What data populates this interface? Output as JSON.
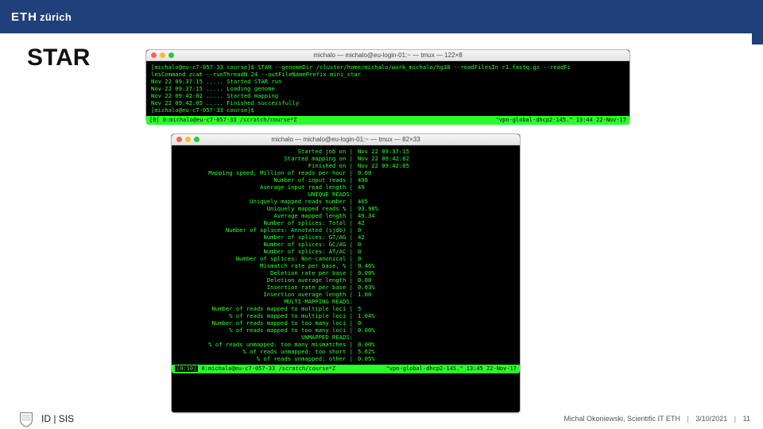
{
  "header": {
    "logo_text_eth": "ETH",
    "logo_text_sub": "zürich"
  },
  "title": "STAR",
  "terminal1": {
    "window_title": "michalo — michalo@eu-login-01:~ — tmux — 122×8",
    "lines": [
      "[michalo@eu-c7-057-33 course]$ STAR --genomeDir /cluster/home/michalo/work_michalo/hg38 --readFilesIn r1.fastq.gz --readFi",
      "lesCommand zcat --runThreadN 24 --outFileNamePrefix mini_star",
      "Nov 22 09:37:15 ..... Started STAR run",
      "Nov 22 09:37:15 ..... Loading genome",
      "Nov 22 09:42:02 ..... Started mapping",
      "Nov 22 09:42:05 ..... Finished successfully",
      "[michalo@eu-c7-057-33 course]$"
    ],
    "status_left": "[0] 0:michalo@eu-c7-057-33 /scratch/course*Z",
    "status_right": "\"vpn-global-dhcp2-145.\" 13:44 22-Nov-17"
  },
  "terminal2": {
    "window_title": "michalo — michalo@eu-login-01:~ — tmux — 82×33",
    "rows": [
      {
        "l": "Started job on |",
        "r": "Nov 22 09:37:15"
      },
      {
        "l": "Started mapping on |",
        "r": "Nov 22 09:42:02"
      },
      {
        "l": "Finished on |",
        "r": "Nov 22 09:42:05"
      },
      {
        "l": "Mapping speed, Million of reads per hour |",
        "r": "0.60"
      },
      {
        "l": "",
        "r": ""
      },
      {
        "l": "Number of input reads |",
        "r": "498"
      },
      {
        "l": "Average input read length |",
        "r": "49"
      },
      {
        "l": "UNIQUE READS:",
        "r": ""
      },
      {
        "l": "Uniquely mapped reads number |",
        "r": "465"
      },
      {
        "l": "Uniquely mapped reads % |",
        "r": "93.98%"
      },
      {
        "l": "Average mapped length |",
        "r": "49.34"
      },
      {
        "l": "Number of splices: Total |",
        "r": "42"
      },
      {
        "l": "Number of splices: Annotated (sjdb) |",
        "r": "0"
      },
      {
        "l": "Number of splices: GT/AG |",
        "r": "42"
      },
      {
        "l": "Number of splices: GC/AG |",
        "r": "0"
      },
      {
        "l": "Number of splices: AT/AC |",
        "r": "0"
      },
      {
        "l": "Number of splices: Non-canonical |",
        "r": "0"
      },
      {
        "l": "Mismatch rate per base, % |",
        "r": "0.46%"
      },
      {
        "l": "Deletion rate per base |",
        "r": "0.00%"
      },
      {
        "l": "Deletion average length |",
        "r": "0.00"
      },
      {
        "l": "Insertion rate per base |",
        "r": "0.03%"
      },
      {
        "l": "Insertion average length |",
        "r": "1.00"
      },
      {
        "l": "MULTI-MAPPING READS:",
        "r": ""
      },
      {
        "l": "Number of reads mapped to multiple loci |",
        "r": "5"
      },
      {
        "l": "% of reads mapped to multiple loci |",
        "r": "1.04%"
      },
      {
        "l": "Number of reads mapped to too many loci |",
        "r": "0"
      },
      {
        "l": "% of reads mapped to too many loci |",
        "r": "0.00%"
      },
      {
        "l": "UNMAPPED READS:",
        "r": ""
      },
      {
        "l": "% of reads unmapped: too many mismatches |",
        "r": "0.00%"
      },
      {
        "l": "% of reads unmapped: too short |",
        "r": "5.62%"
      },
      {
        "l": "% of reads unmapped: other |",
        "r": "0.05%"
      }
    ],
    "status_badge": "[0:10]",
    "status_left": "0:michalo@eu-c7-057-33 /scratch/course*Z",
    "status_right": "\"vpn-global-dhcp2-145.\" 13:45 22-Nov-17"
  },
  "footer": {
    "dept": "ID | SIS",
    "author": "Michal Okoniewski, Scientific IT ETH",
    "date": "3/10/2021",
    "page": "11",
    "sep": "|"
  }
}
